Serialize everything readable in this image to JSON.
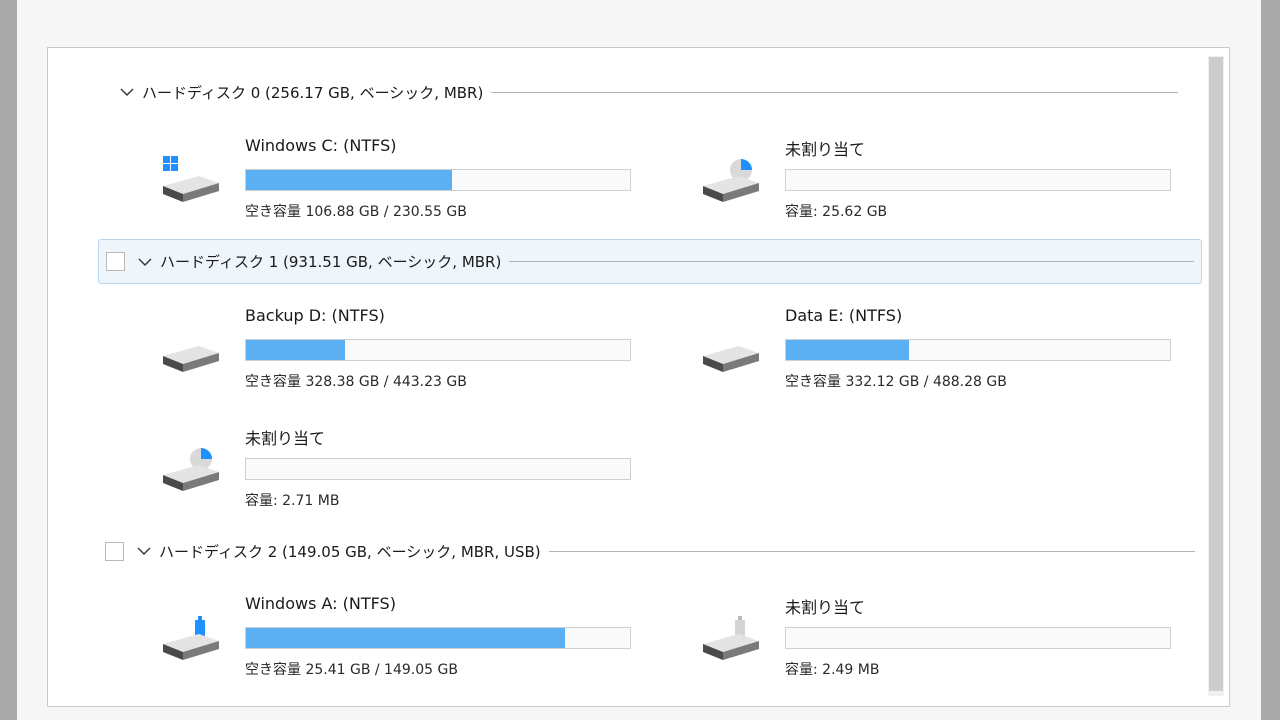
{
  "colors": {
    "bar_fill": "#5ab0f3",
    "selected_bg": "#eef5fb"
  },
  "disks": [
    {
      "title": "ハードディスク 0 (256.17 GB, ベーシック, MBR)",
      "partitions": [
        {
          "name": "Windows C: (NTFS)",
          "info": "空き容量 106.88 GB / 230.55 GB",
          "used_fraction": 0.536,
          "icon": "windows-drive-icon"
        },
        {
          "name": "未割り当て",
          "info": "容量: 25.62 GB",
          "used_fraction": 0,
          "icon": "unallocated-drive-icon"
        }
      ]
    },
    {
      "title": "ハードディスク 1 (931.51 GB, ベーシック, MBR)",
      "partitions": [
        {
          "name": "Backup D: (NTFS)",
          "info": "空き容量 328.38 GB / 443.23 GB",
          "used_fraction": 0.259,
          "icon": "drive-icon"
        },
        {
          "name": "Data E: (NTFS)",
          "info": "空き容量 332.12 GB / 488.28 GB",
          "used_fraction": 0.32,
          "icon": "drive-icon"
        },
        {
          "name": "未割り当て",
          "info": "容量: 2.71 MB",
          "used_fraction": 0,
          "icon": "unallocated-drive-icon"
        }
      ]
    },
    {
      "title": "ハードディスク 2 (149.05 GB, ベーシック, MBR, USB)",
      "partitions": [
        {
          "name": "Windows A: (NTFS)",
          "info": "空き容量 25.41 GB / 149.05 GB",
          "used_fraction": 0.83,
          "icon": "usb-drive-icon"
        },
        {
          "name": "未割り当て",
          "info": "容量: 2.49 MB",
          "used_fraction": 0,
          "icon": "usb-unallocated-drive-icon"
        }
      ]
    }
  ]
}
